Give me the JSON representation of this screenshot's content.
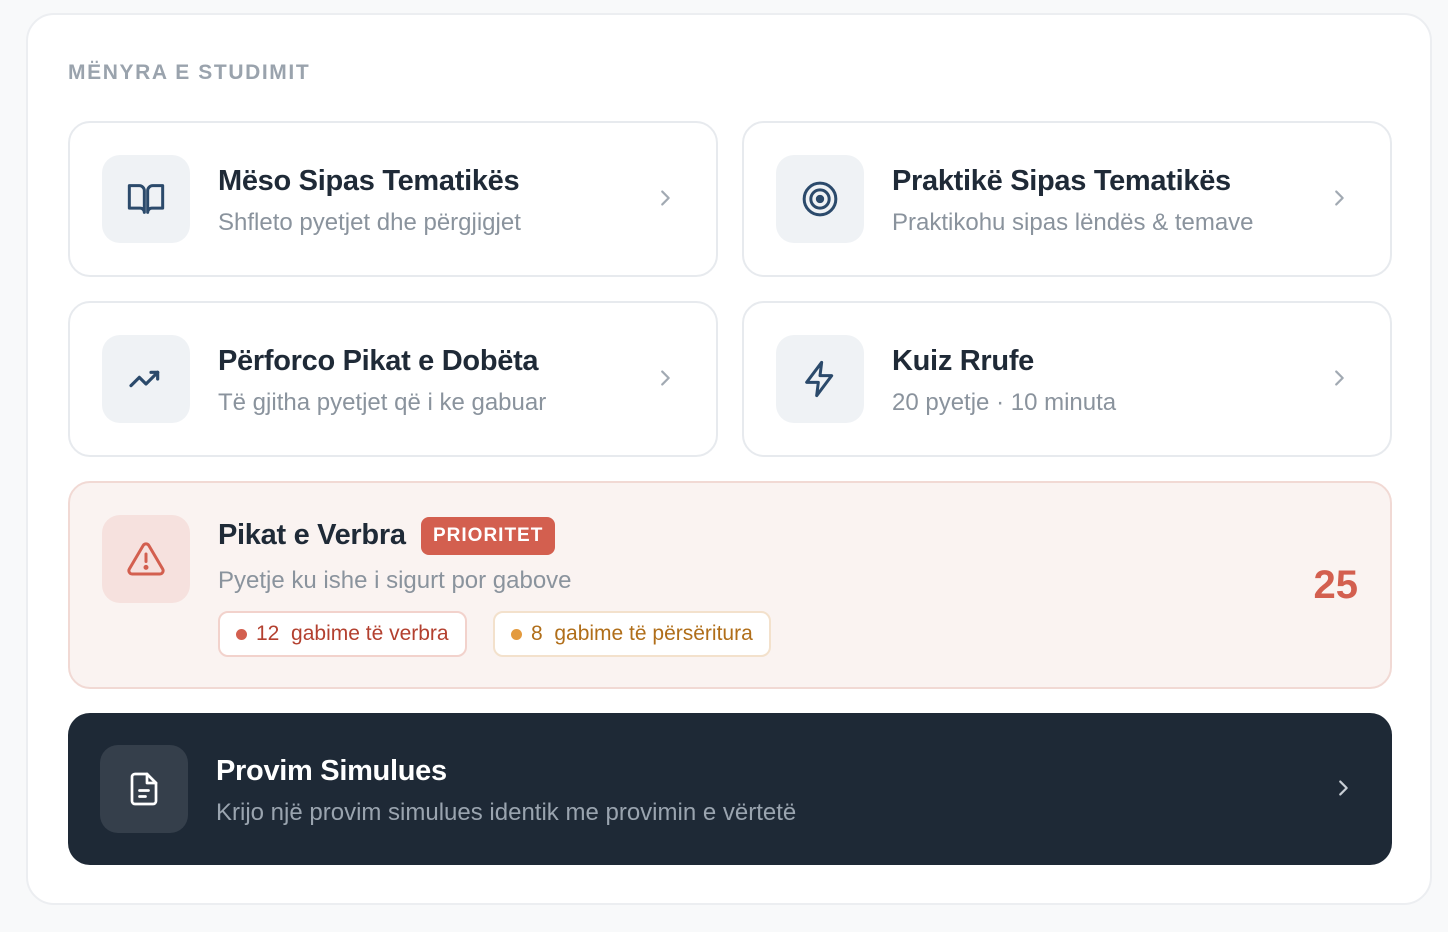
{
  "section": {
    "title": "MËNYRA E STUDIMIT"
  },
  "cards": [
    {
      "title": "Mëso Sipas Tematikës",
      "subtitle": "Shfleto pyetjet dhe përgjigjet",
      "icon": "book-open-icon"
    },
    {
      "title": "Praktikë Sipas Tematikës",
      "subtitle": "Praktikohu sipas lëndës & temave",
      "icon": "target-icon"
    },
    {
      "title": "Përforco Pikat e Dobëta",
      "subtitle": "Të gjitha pyetjet që i ke gabuar",
      "icon": "trending-up-icon"
    },
    {
      "title": "Kuiz Rrufe",
      "subtitle": "20 pyetje · 10 minuta",
      "icon": "lightning-icon"
    }
  ],
  "blind_spots": {
    "title": "Pikat e Verbra",
    "badge": "PRIORITET",
    "subtitle": "Pyetje ku ishe i sigurt por gabove",
    "chip_blind": "12  gabime të verbra",
    "chip_repeated": "8  gabime të përsëritura",
    "count": "25",
    "icon": "warning-triangle-icon"
  },
  "exam": {
    "title": "Provim Simulues",
    "subtitle": "Krijo një provim simulues identik me provimin e vërtetë",
    "icon": "document-icon"
  },
  "colors": {
    "accent_red": "#d35f4f",
    "accent_orange": "#e39a3e",
    "dark_card": "#1e2936",
    "icon_stroke": "#2b4a6b"
  }
}
